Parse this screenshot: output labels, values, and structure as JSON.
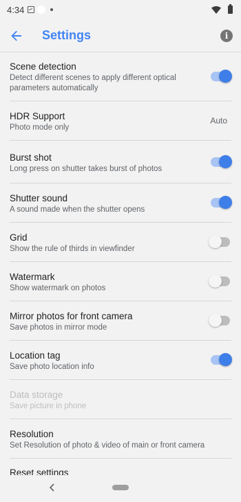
{
  "status_bar": {
    "time": "4:34"
  },
  "app_bar": {
    "title": "Settings",
    "info_glyph": "i"
  },
  "settings": [
    {
      "title": "Scene detection",
      "subtitle": "Detect different scenes to apply different optical parameters automatically",
      "control": "switch",
      "on": true,
      "enabled": true
    },
    {
      "title": "HDR Support",
      "subtitle": "Photo mode only",
      "control": "value",
      "value": "Auto",
      "enabled": true
    },
    {
      "title": "Burst shot",
      "subtitle": "Long press on shutter takes burst of photos",
      "control": "switch",
      "on": true,
      "enabled": true
    },
    {
      "title": "Shutter sound",
      "subtitle": "A sound made when the shutter opens",
      "control": "switch",
      "on": true,
      "enabled": true
    },
    {
      "title": "Grid",
      "subtitle": "Show the rule of thirds in viewfinder",
      "control": "switch",
      "on": false,
      "enabled": true
    },
    {
      "title": "Watermark",
      "subtitle": "Show watermark on photos",
      "control": "switch",
      "on": false,
      "enabled": true
    },
    {
      "title": "Mirror photos for front camera",
      "subtitle": "Save photos in mirror mode",
      "control": "switch",
      "on": false,
      "enabled": true
    },
    {
      "title": "Location tag",
      "subtitle": "Save photo location info",
      "control": "switch",
      "on": true,
      "enabled": true
    },
    {
      "title": "Data storage",
      "subtitle": "Save picture in phone",
      "control": "none",
      "enabled": false
    },
    {
      "title": "Resolution",
      "subtitle": "Set Resolution of photo & video of main or front camera",
      "control": "none",
      "enabled": true
    },
    {
      "title": "Reset settings",
      "subtitle": "",
      "control": "none",
      "enabled": true
    }
  ],
  "colors": {
    "accent": "#4285f4",
    "switch_on_thumb": "#3e7ee8",
    "switch_on_track": "#a8c4f4",
    "switch_off_track": "#bdbdbd",
    "background": "#f2f2f2"
  }
}
